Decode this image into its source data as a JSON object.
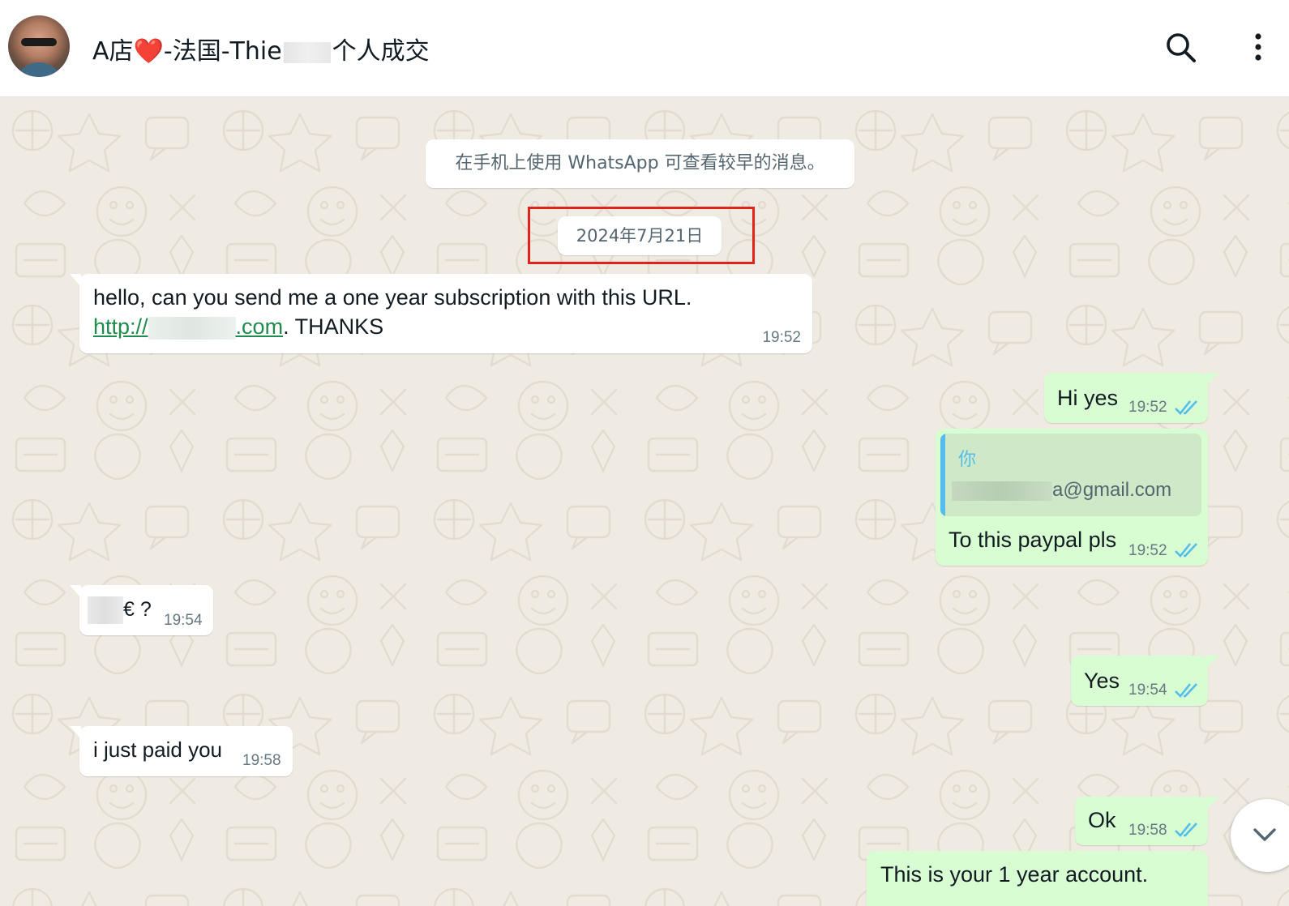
{
  "header": {
    "title_prefix": "A店",
    "heart": "❤️",
    "title_mid": "-法国-Thie",
    "title_suffix": "个人成交",
    "search_icon": "search-icon",
    "menu_icon": "more-vertical-icon"
  },
  "system_note": "在手机上使用 WhatsApp 可查看较早的消息。",
  "date_chip": "2024年7月21日",
  "messages": [
    {
      "direction": "in",
      "line1": "hello, can you send me a one year subscription with this URL.",
      "link_start": "http://",
      "link_end": ".com",
      "line2_tail": ". THANKS",
      "time": "19:52"
    },
    {
      "direction": "out",
      "text": "Hi yes",
      "time": "19:52",
      "status": "read"
    },
    {
      "direction": "out",
      "quote_author": "你",
      "quote_text": "a@gmail.com",
      "text": "To this paypal pls",
      "time": "19:52",
      "status": "read"
    },
    {
      "direction": "in",
      "text": "€ ?",
      "time": "19:54"
    },
    {
      "direction": "out",
      "text": "Yes",
      "time": "19:54",
      "status": "read"
    },
    {
      "direction": "in",
      "text": "i just paid you",
      "time": "19:58"
    },
    {
      "direction": "out",
      "text": "Ok",
      "time": "19:58",
      "status": "read"
    },
    {
      "direction": "out",
      "text": "This is your 1 year account."
    }
  ],
  "colors": {
    "incoming_bubble": "#ffffff",
    "outgoing_bubble": "#d9fdd3",
    "read_ticks": "#53bdeb",
    "highlight_box": "#e2231a",
    "wallpaper": "#efeae2"
  }
}
